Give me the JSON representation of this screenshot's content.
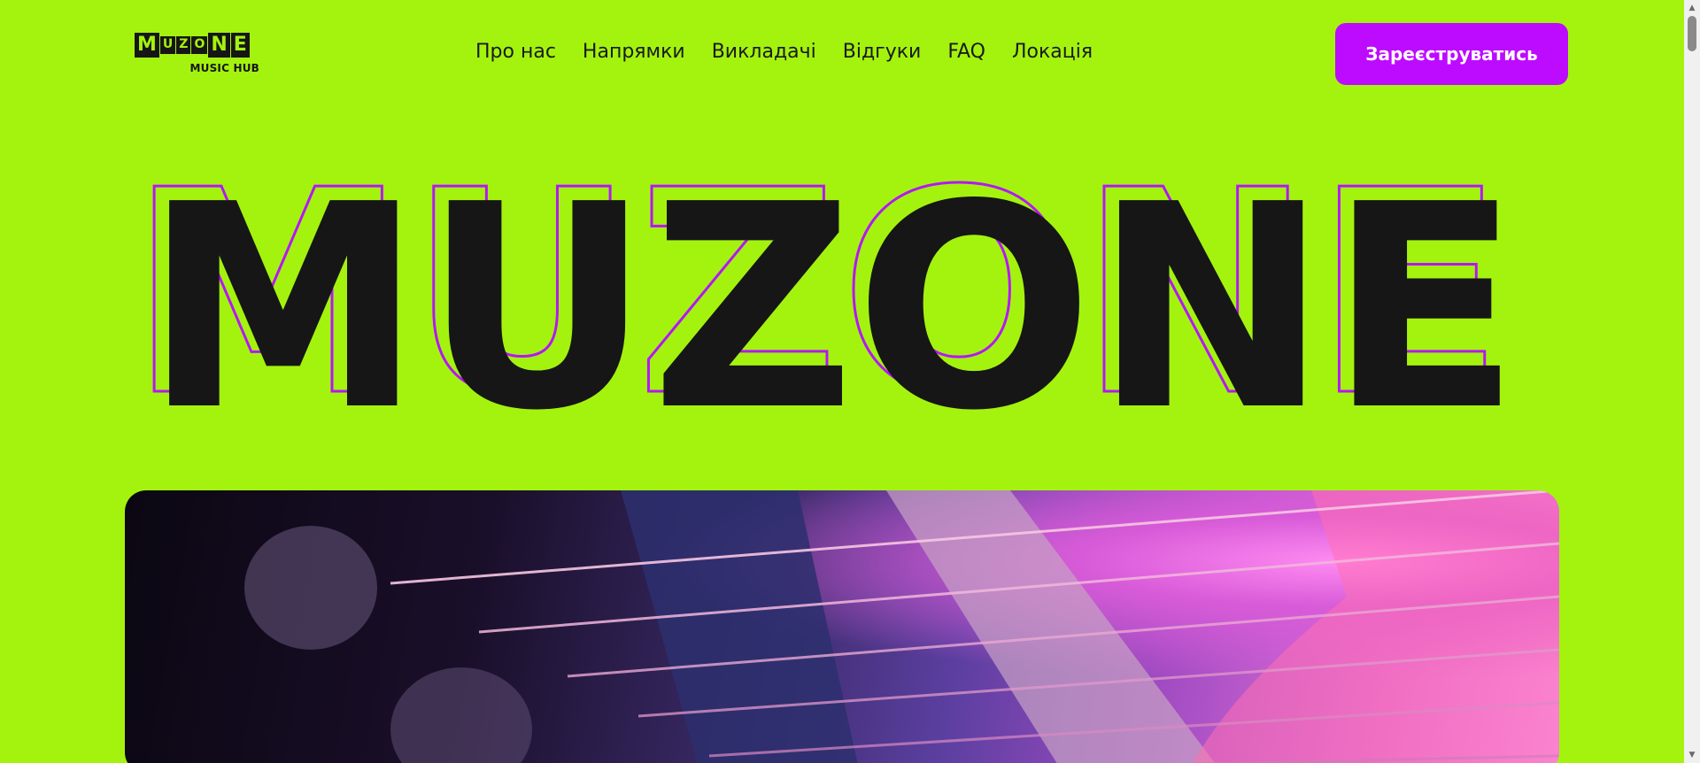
{
  "header": {
    "logo": {
      "letters": [
        "M",
        "U",
        "Z",
        "O",
        "N",
        "E"
      ],
      "subtitle": "MUSIC HUB"
    },
    "nav": [
      {
        "label": "Про нас"
      },
      {
        "label": "Напрямки"
      },
      {
        "label": "Викладачі"
      },
      {
        "label": "Відгуки"
      },
      {
        "label": "FAQ"
      },
      {
        "label": "Локація"
      }
    ],
    "cta_label": "Зареєструватись"
  },
  "hero": {
    "title": "MUZONE",
    "image_subject": "guitar-strings-photo"
  },
  "colors": {
    "background": "#a4f30f",
    "accent": "#bc0bff",
    "outline": "#b516f5",
    "text_dark": "#161616"
  },
  "scrollbar": {
    "icon_up": "scroll-up-arrow-icon",
    "icon_down": "scroll-down-arrow-icon"
  }
}
